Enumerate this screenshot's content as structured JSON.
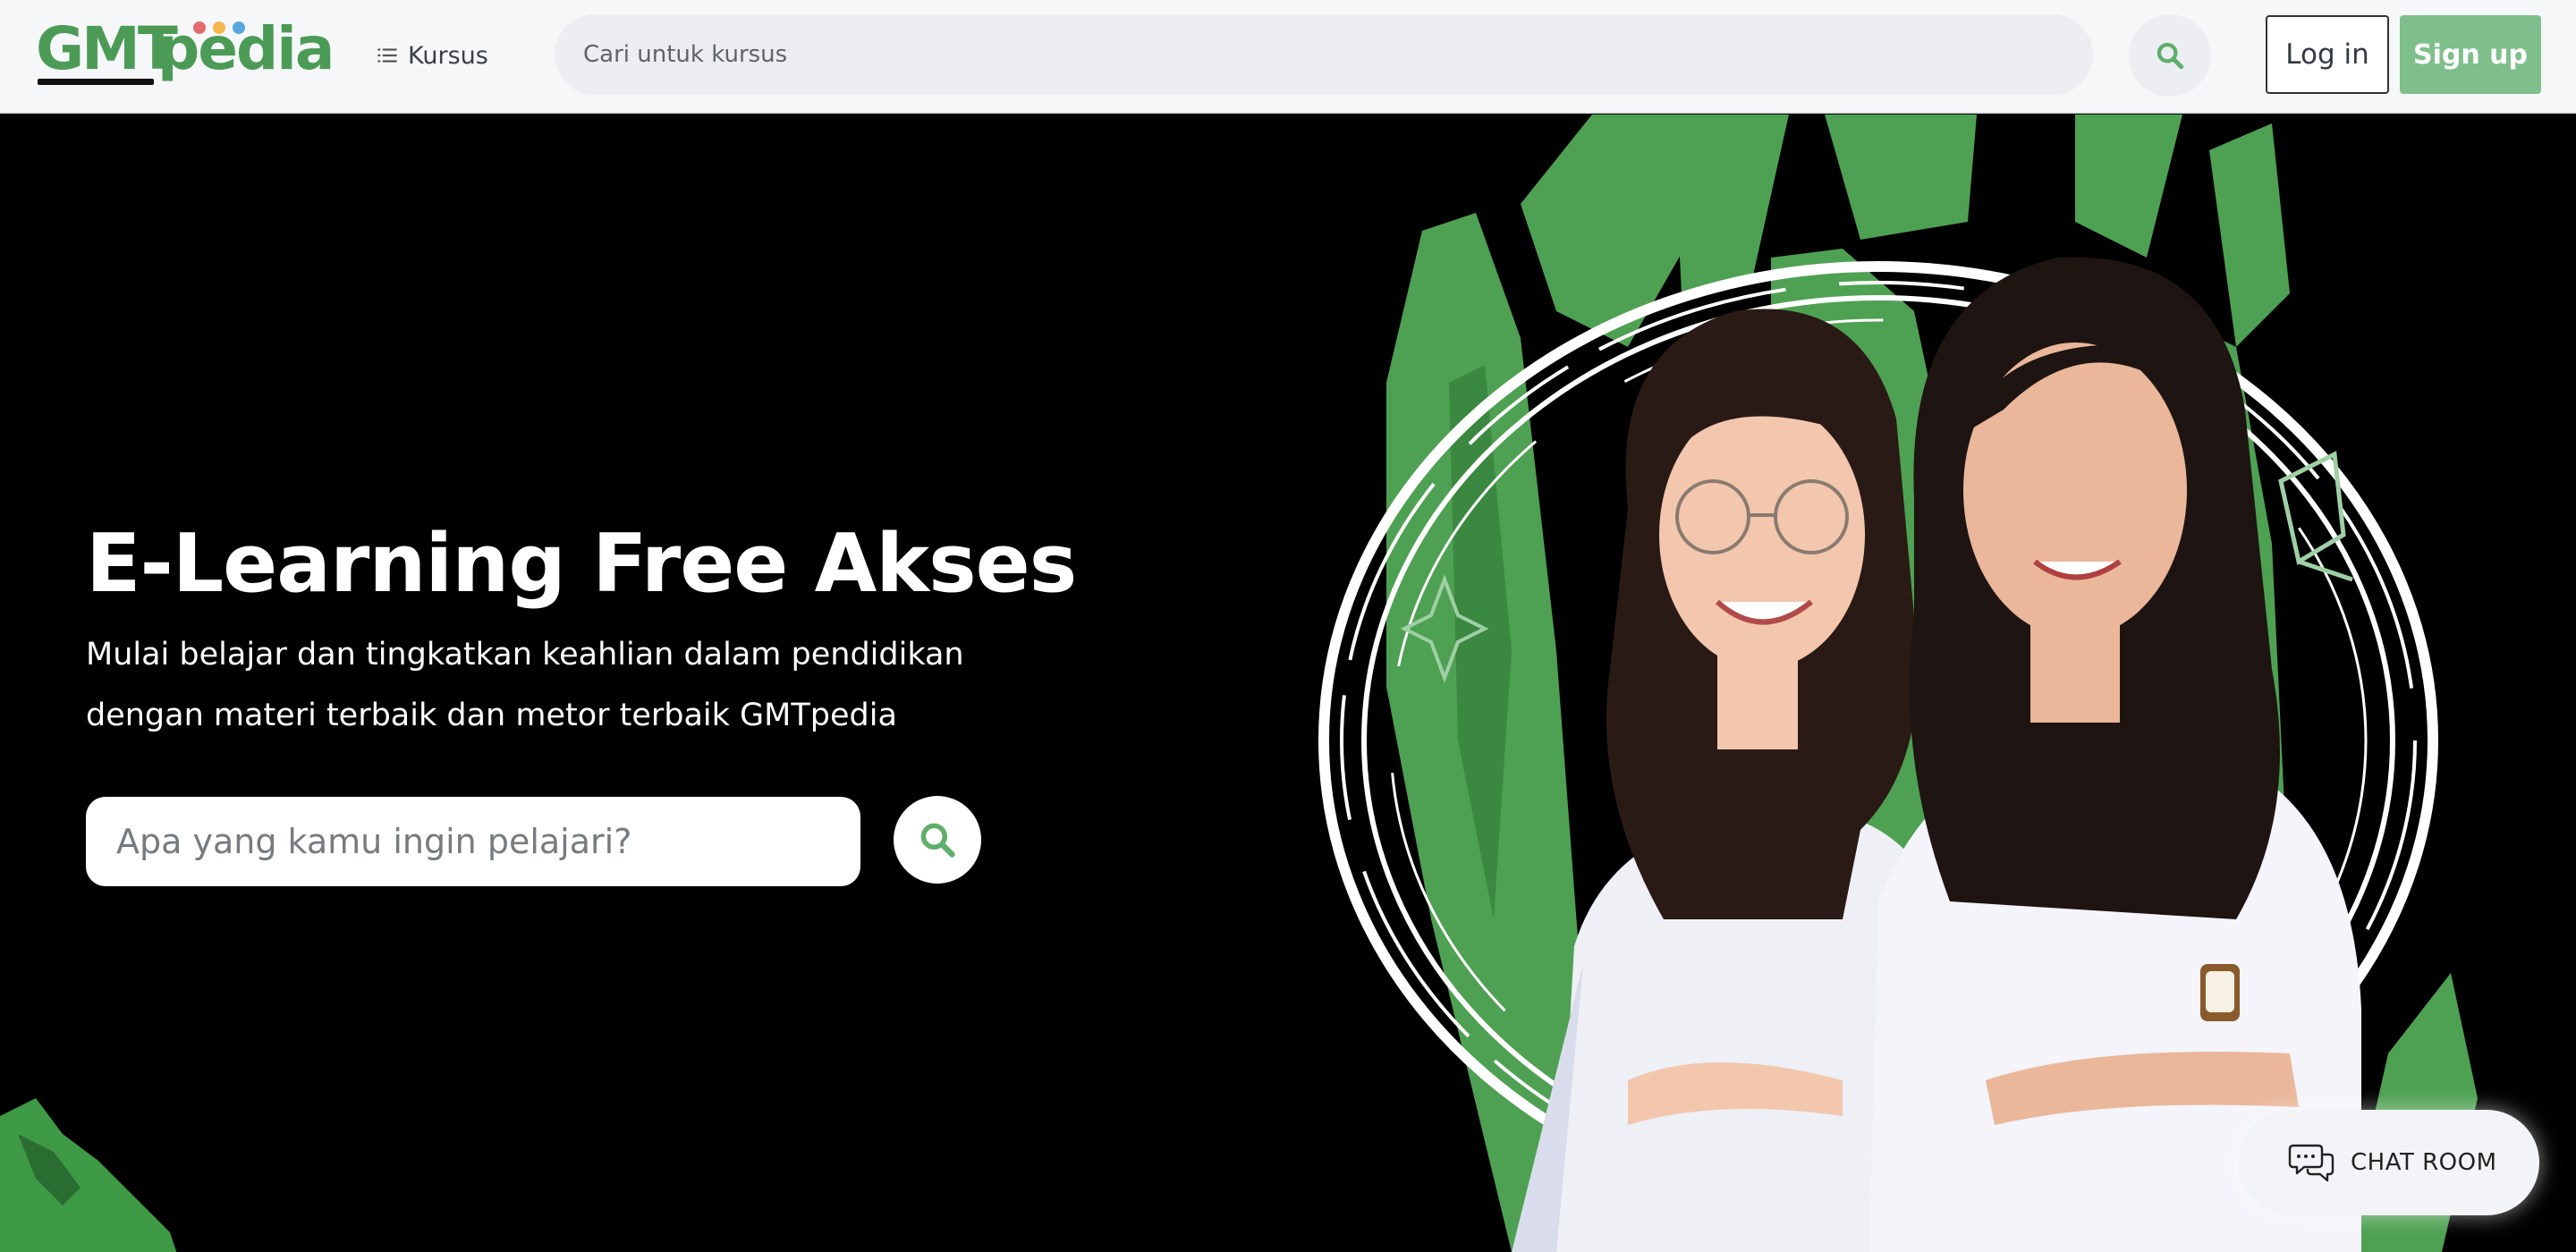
{
  "brand": {
    "logo_part1": "GMT",
    "logo_part2": "pedia",
    "green": "#4b9b57",
    "dot_colors": [
      "#e56b6f",
      "#f2b84b",
      "#5aa7e0"
    ]
  },
  "nav": {
    "kursus_label": "Kursus",
    "search_placeholder": "Cari untuk kursus",
    "login_label": "Log in",
    "signup_label": "Sign up"
  },
  "hero": {
    "title": "E-Learning Free Akses",
    "subtitle_line1": "Mulai belajar dan tingkatkan keahlian dalam pendidikan",
    "subtitle_line2": "dengan materi terbaik dan metor terbaik GMTpedia",
    "search_placeholder": "Apa yang kamu ingin pelajari?",
    "accent": "#4ea152"
  },
  "chat": {
    "label": "CHAT ROOM"
  },
  "icons": {
    "menu": "list-icon",
    "search": "search-icon",
    "chat": "chat-bubbles-icon"
  }
}
